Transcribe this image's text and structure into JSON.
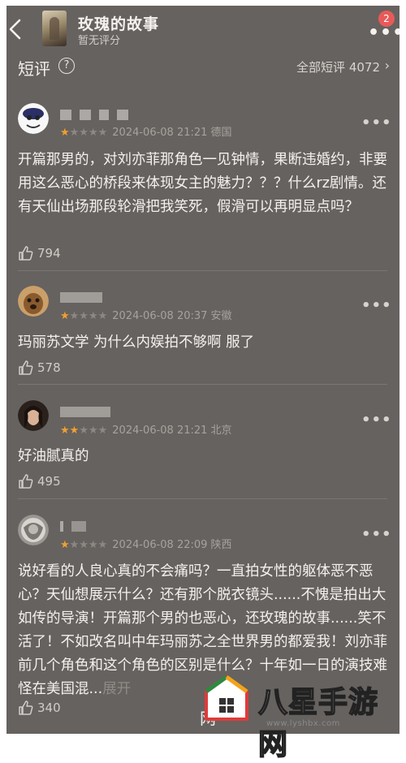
{
  "header": {
    "title": "玫瑰的故事",
    "subtitle": "暂无评分",
    "more_label": "•••",
    "badge_count": "2"
  },
  "section": {
    "title": "短评",
    "help_label": "?",
    "all_label": "全部短评 4072",
    "chevron": "›"
  },
  "reviews": [
    {
      "date_location": "2024-06-08 21:21 德国",
      "stars": 1,
      "text": "开篇那男的，对刘亦菲那角色一见钟情，果断违婚约，非要用这么恶心的桥段来体现女主的魅力？？？什么rz剧情。还有天仙出场那段轮滑把我笑死，假滑可以再明显点吗？",
      "likes": "794"
    },
    {
      "date_location": "2024-06-08 20:37 安徽",
      "stars": 1,
      "text": "玛丽苏文学 为什么内娱拍不够啊 服了",
      "likes": "578"
    },
    {
      "date_location": "2024-06-08 21:21 北京",
      "stars": 2,
      "text": "好油腻真的",
      "likes": "495"
    },
    {
      "date_location": "2024-06-08 22:09 陕西",
      "stars": 1,
      "text": "说好看的人良心真的不会痛吗？一直拍女性的躯体恶不恶心？天仙想展示什么？还有那个脱衣镜头......不愧是拍出大如传的导演！开篇那个男的也恶心，还玫瑰的故事......笑不活了！不如改名叫中年玛丽苏之全世界男的都爱我！刘亦菲前几个角色和这个角色的区别是什么？十年如一日的演技难怪在美国混...",
      "expand": "展开",
      "likes": "340"
    }
  ],
  "watermark": {
    "text": "八星手游网",
    "url": "www.lyshbx.com",
    "ghost": "网"
  },
  "colors": {
    "background": "#66625f",
    "star_on": "#f0a030",
    "star_off": "#8d8883",
    "badge": "#e85a5a"
  }
}
